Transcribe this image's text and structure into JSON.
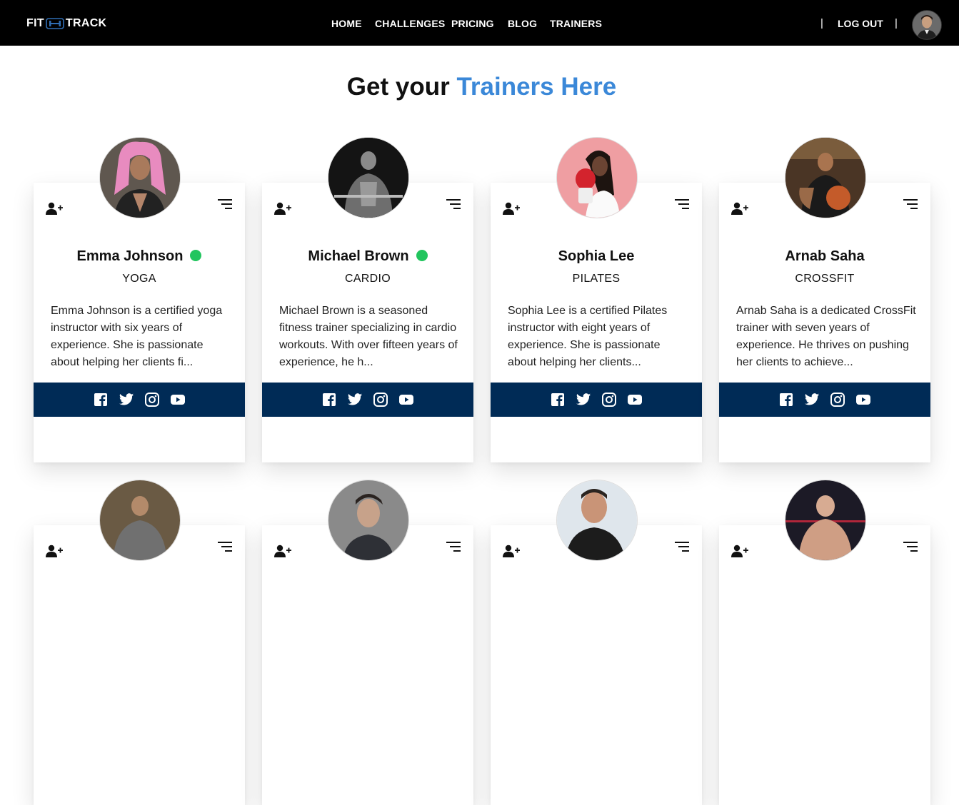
{
  "nav": {
    "logo_left": "FIT",
    "logo_right": "TRACK",
    "links": [
      "HOME",
      "CHALLENGES",
      "PRICING",
      "BLOG",
      "TRAINERS"
    ],
    "separator": "|",
    "logout": "LOG OUT"
  },
  "heading": {
    "prefix": "Get your ",
    "highlight": "Trainers Here"
  },
  "colors": {
    "accent": "#3b88d8",
    "social_bar": "#002b56",
    "online": "#22c55e"
  },
  "trainers": [
    {
      "name": "Emma Johnson",
      "specialty": "YOGA",
      "online": true,
      "bio": "Emma Johnson is a certified yoga instructor with six years of experience. She is passionate about helping her clients fi..."
    },
    {
      "name": "Michael Brown",
      "specialty": "CARDIO",
      "online": true,
      "bio": "Michael Brown is a seasoned fitness trainer specializing in cardio workouts. With over fifteen years of experience, he h..."
    },
    {
      "name": "Sophia Lee",
      "specialty": "PILATES",
      "online": false,
      "bio": "Sophia Lee is a certified Pilates instructor with eight years of experience. She is passionate about helping her clients..."
    },
    {
      "name": "Arnab Saha",
      "specialty": "CROSSFIT",
      "online": false,
      "bio": "Arnab Saha is a dedicated CrossFit trainer with seven years of experience. He thrives on pushing her clients to achieve..."
    }
  ],
  "icons": {
    "card_left": "add-user-icon",
    "card_right": "menu-icon",
    "social": [
      "facebook-icon",
      "twitter-icon",
      "instagram-icon",
      "youtube-icon"
    ]
  }
}
